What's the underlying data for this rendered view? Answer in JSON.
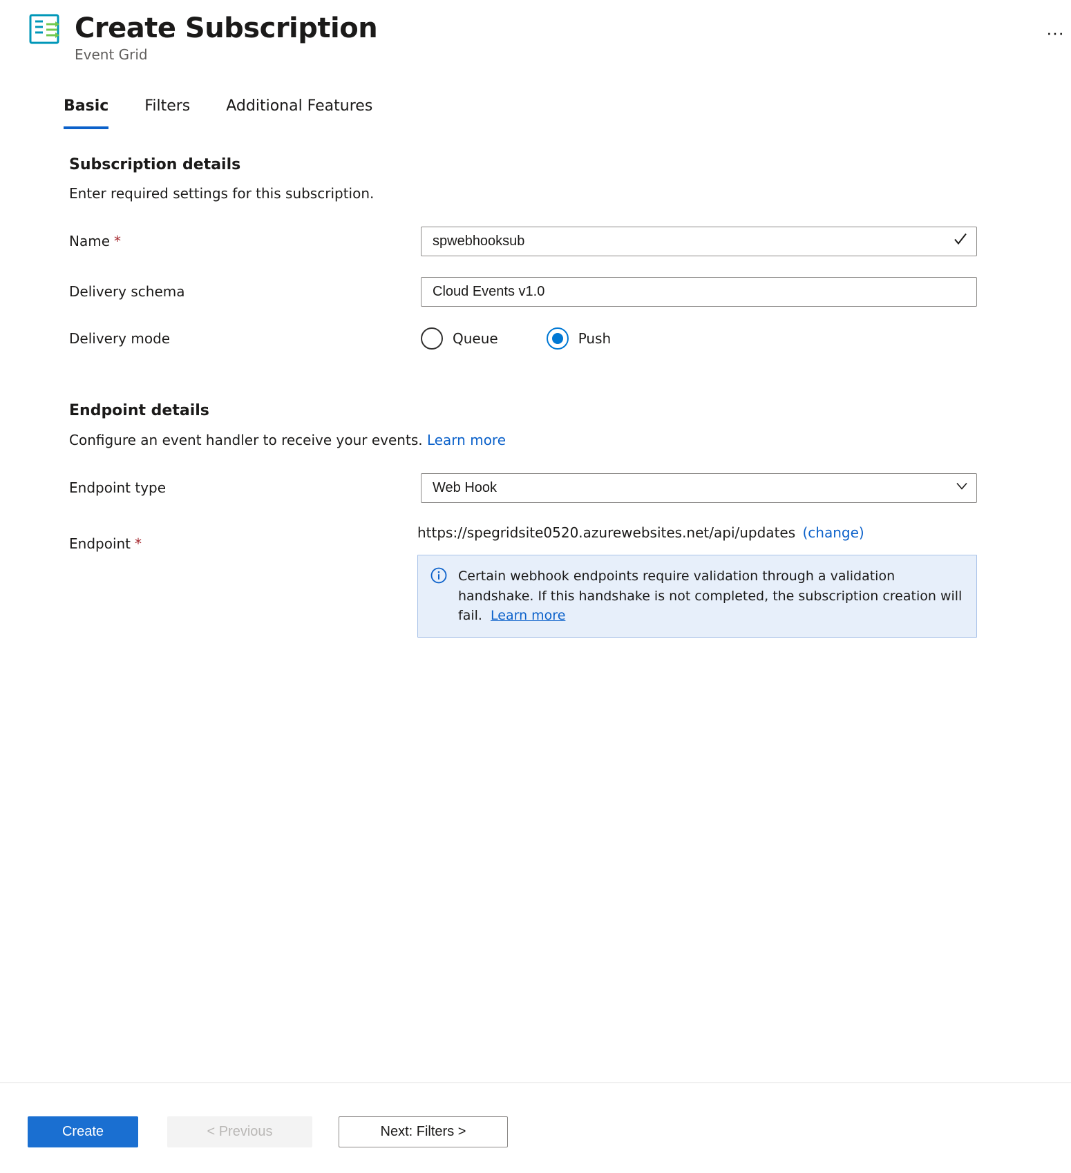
{
  "header": {
    "title": "Create Subscription",
    "subtitle": "Event Grid"
  },
  "tabs": [
    {
      "label": "Basic",
      "active": true
    },
    {
      "label": "Filters",
      "active": false
    },
    {
      "label": "Additional Features",
      "active": false
    }
  ],
  "sections": {
    "subscription": {
      "title": "Subscription details",
      "desc": "Enter required settings for this subscription.",
      "name_label": "Name",
      "name_value": "spwebhooksub",
      "schema_label": "Delivery schema",
      "schema_value": "Cloud Events v1.0",
      "mode_label": "Delivery mode",
      "mode_options": {
        "queue": "Queue",
        "push": "Push"
      },
      "mode_selected": "push"
    },
    "endpoint": {
      "title": "Endpoint details",
      "desc": "Configure an event handler to receive your events.",
      "learn_more": "Learn more",
      "type_label": "Endpoint type",
      "type_value": "Web Hook",
      "endpoint_label": "Endpoint",
      "endpoint_value": "https://spegridsite0520.azurewebsites.net/api/updates",
      "change_label": "(change)",
      "info_text": "Certain webhook endpoints require validation through a validation handshake. If this handshake is not completed, the subscription creation will fail.",
      "info_learn_more": "Learn more"
    }
  },
  "footer": {
    "create": "Create",
    "previous": "<  Previous",
    "next": "Next: Filters  >"
  }
}
